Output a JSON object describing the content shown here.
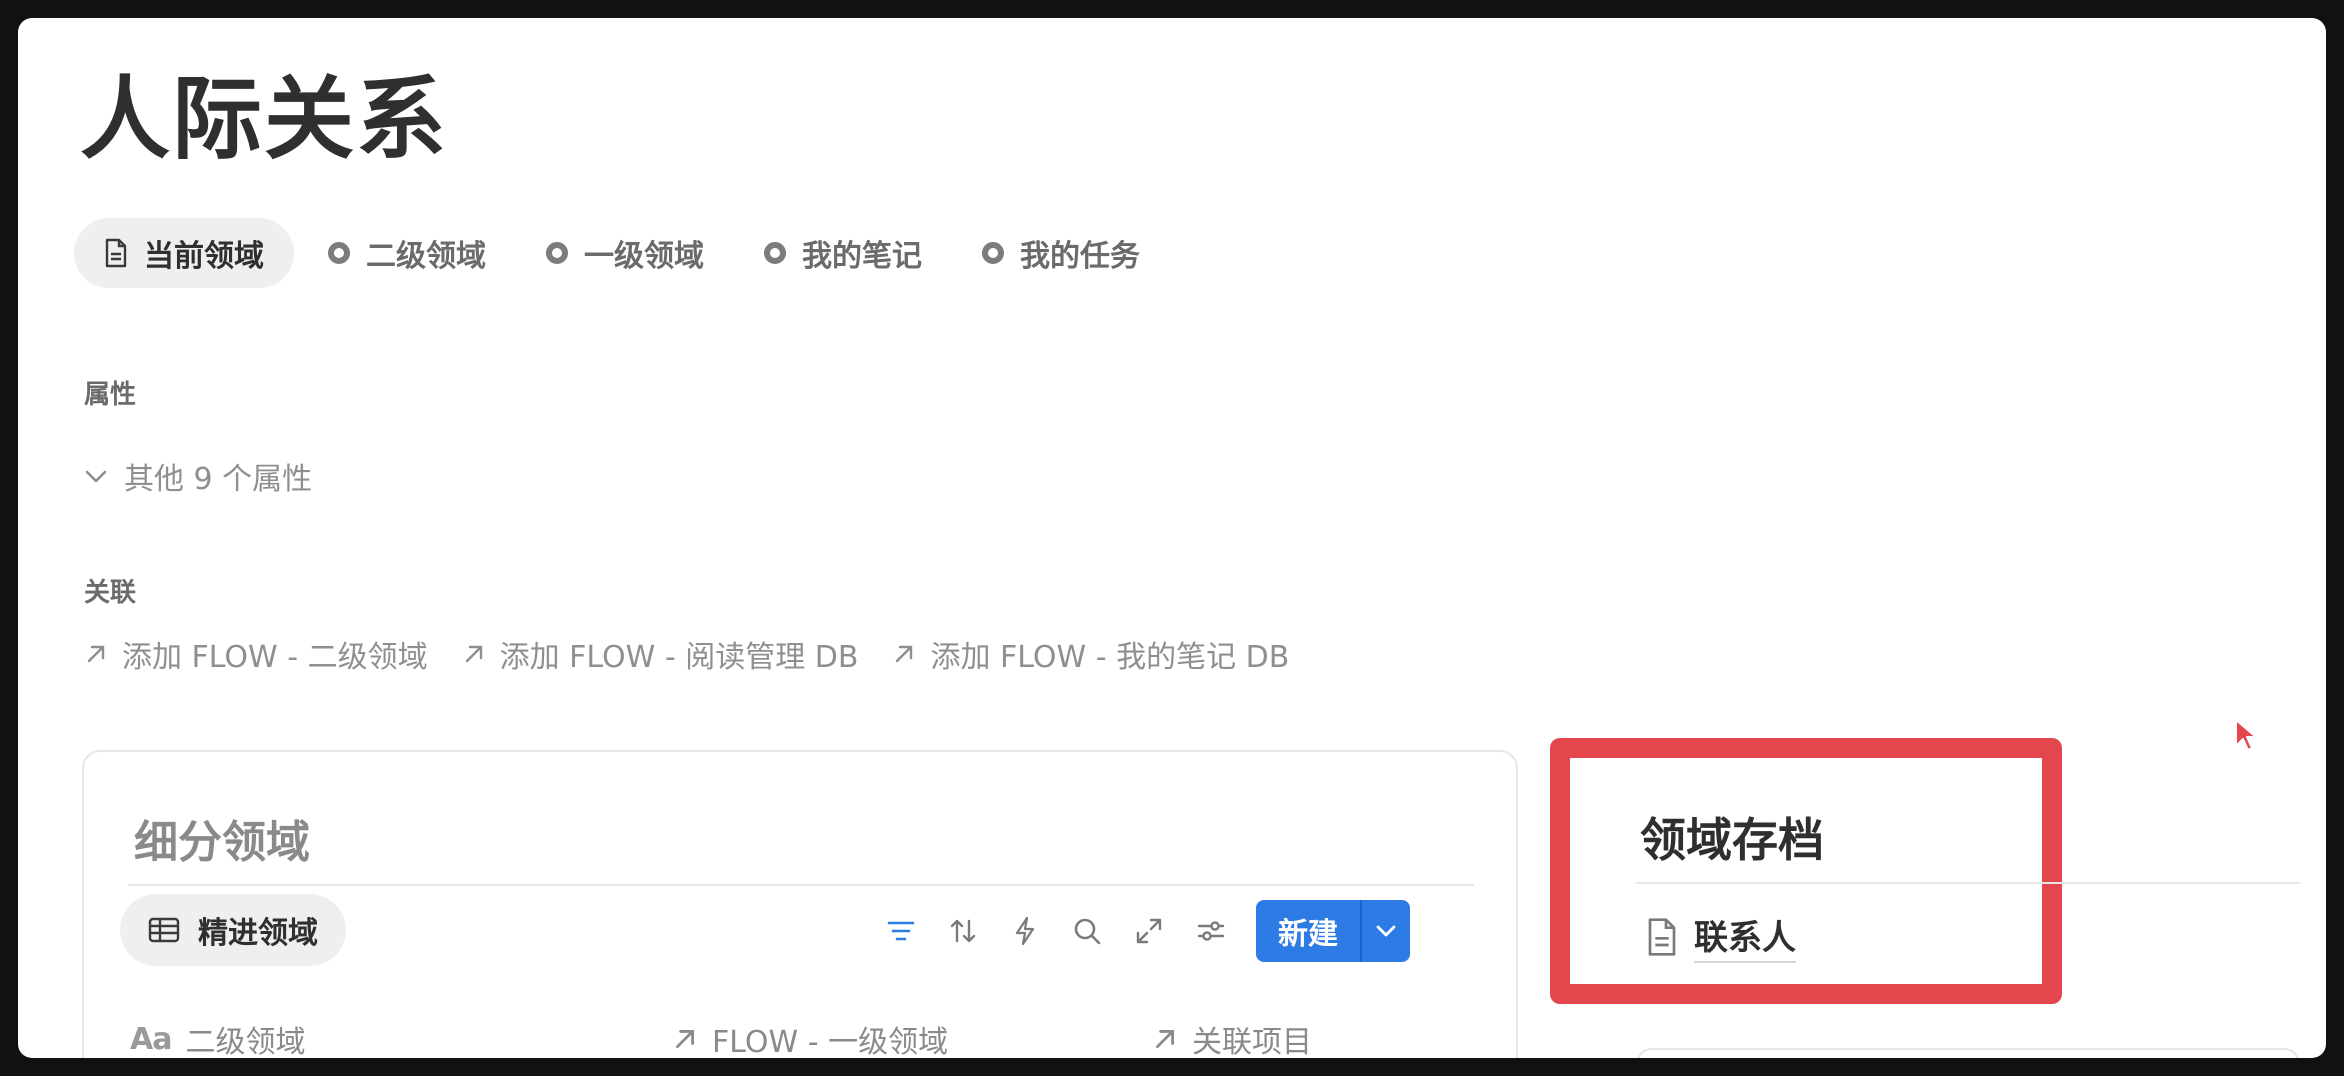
{
  "page": {
    "title": "人际关系"
  },
  "tabs": [
    {
      "label": "当前领域",
      "active": true,
      "icon": "page-icon"
    },
    {
      "label": "二级领域",
      "icon": "ring-icon"
    },
    {
      "label": "一级领域",
      "icon": "ring-icon"
    },
    {
      "label": "我的笔记",
      "icon": "ring-icon"
    },
    {
      "label": "我的任务",
      "icon": "ring-icon"
    }
  ],
  "properties": {
    "heading": "属性",
    "more_label": "其他 9 个属性"
  },
  "relations": {
    "heading": "关联",
    "items": [
      "添加 FLOW - 二级领域",
      "添加 FLOW - 阅读管理 DB",
      "添加 FLOW - 我的笔记 DB"
    ]
  },
  "subdomain_card": {
    "title": "细分领域",
    "view_tab": "精进领域",
    "new_button": "新建",
    "columns": [
      {
        "icon": "aa-text-icon",
        "icon_text": "Aa",
        "label": "二级领域"
      },
      {
        "icon": "relation-arrow-icon",
        "label": "FLOW - 一级领域"
      },
      {
        "icon": "relation-arrow-icon",
        "label": "关联项目"
      }
    ]
  },
  "archive": {
    "title": "领域存档",
    "items": [
      {
        "label": "联系人",
        "icon": "page-icon"
      }
    ]
  },
  "colors": {
    "accent_blue": "#2d7be4",
    "highlight_red": "#e3464d",
    "text_primary": "#2f2f2f",
    "text_muted": "#8f8f8f"
  }
}
